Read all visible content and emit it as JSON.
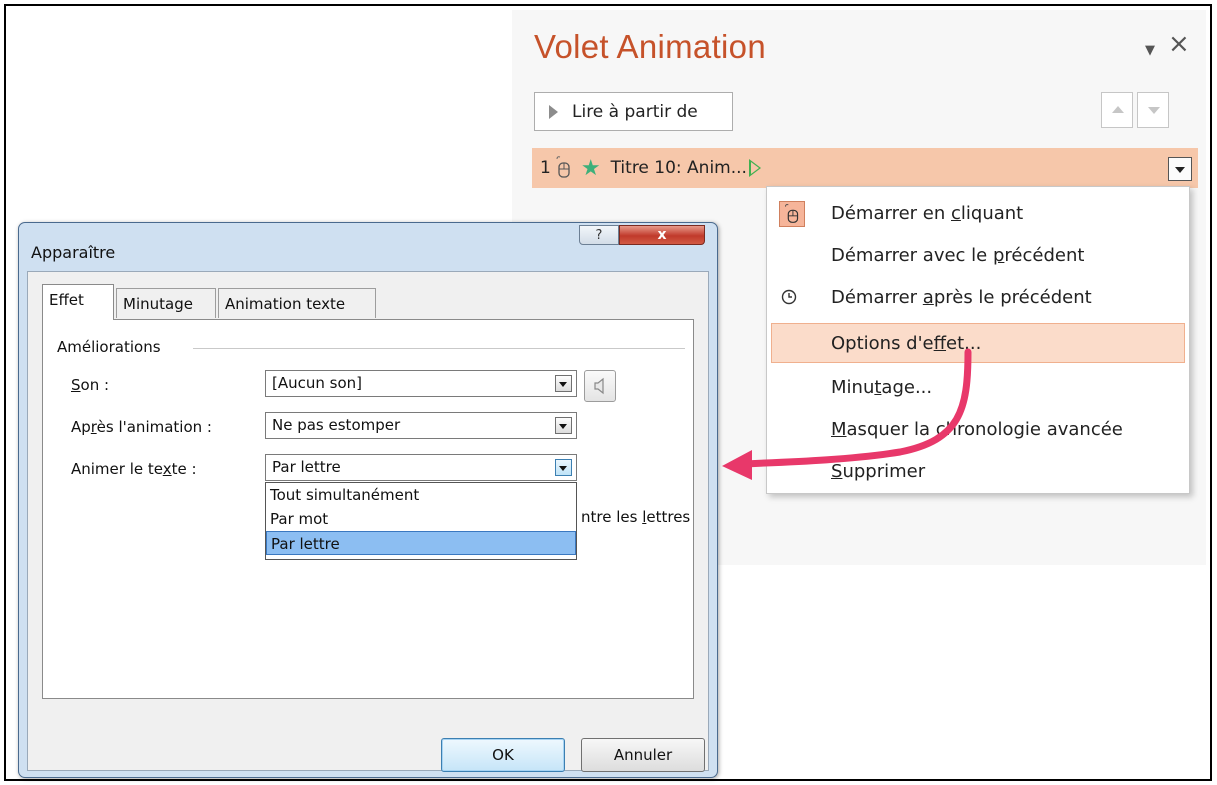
{
  "pane": {
    "title": "Volet Animation",
    "play_button": "Lire à partir de",
    "collapse_icon": "triangle-down",
    "close_icon": "×",
    "animation_item": {
      "number": "1",
      "label": "Titre 10: Anim..."
    }
  },
  "context_menu": {
    "items": [
      {
        "pre": "Démarrer en ",
        "ul": "c",
        "post": "liquant",
        "icon": "mouse-icon"
      },
      {
        "pre": "Démarrer avec le ",
        "ul": "p",
        "post": "récédent",
        "icon": ""
      },
      {
        "pre": "Démarrer ",
        "ul": "a",
        "post": "près le précédent",
        "icon": "clock-icon"
      },
      {
        "pre": "Options d'e",
        "ul": "f",
        "post": "fet...",
        "icon": ""
      },
      {
        "pre": "Minu",
        "ul": "t",
        "post": "age...",
        "icon": ""
      },
      {
        "pre": "",
        "ul": "M",
        "post": "asquer la chronologie avancée",
        "icon": ""
      },
      {
        "pre": "",
        "ul": "S",
        "post": "upprimer",
        "icon": ""
      }
    ],
    "highlighted_index": 3
  },
  "dialog": {
    "title": "Apparaître",
    "help_label": "?",
    "close_label": "x",
    "tabs": [
      "Effet",
      "Minutage",
      "Animation texte"
    ],
    "group_label": "Améliorations",
    "fields": {
      "sound": {
        "label_pre": "",
        "label_ul": "S",
        "label_post": "on :",
        "value": "[Aucun son]"
      },
      "after": {
        "label_pre": "Ap",
        "label_ul": "r",
        "label_post": "ès l'animation :",
        "value": "Ne pas estomper"
      },
      "text": {
        "label_pre": "Animer le te",
        "label_ul": "x",
        "label_post": "te :",
        "value": "Par lettre"
      }
    },
    "dropdown_options": [
      "Tout simultanément",
      "Par mot",
      "Par lettre"
    ],
    "selected_option_index": 2,
    "partial_text_pre": "ntre les ",
    "partial_text_ul": "l",
    "partial_text_post": "ettres",
    "ok_label": "OK",
    "cancel_label": "Annuler"
  },
  "colors": {
    "title_orange": "#c6522a",
    "row_highlight": "#f6c7aa",
    "arrow_pink": "#e8386a",
    "star_green": "#3db07a"
  }
}
